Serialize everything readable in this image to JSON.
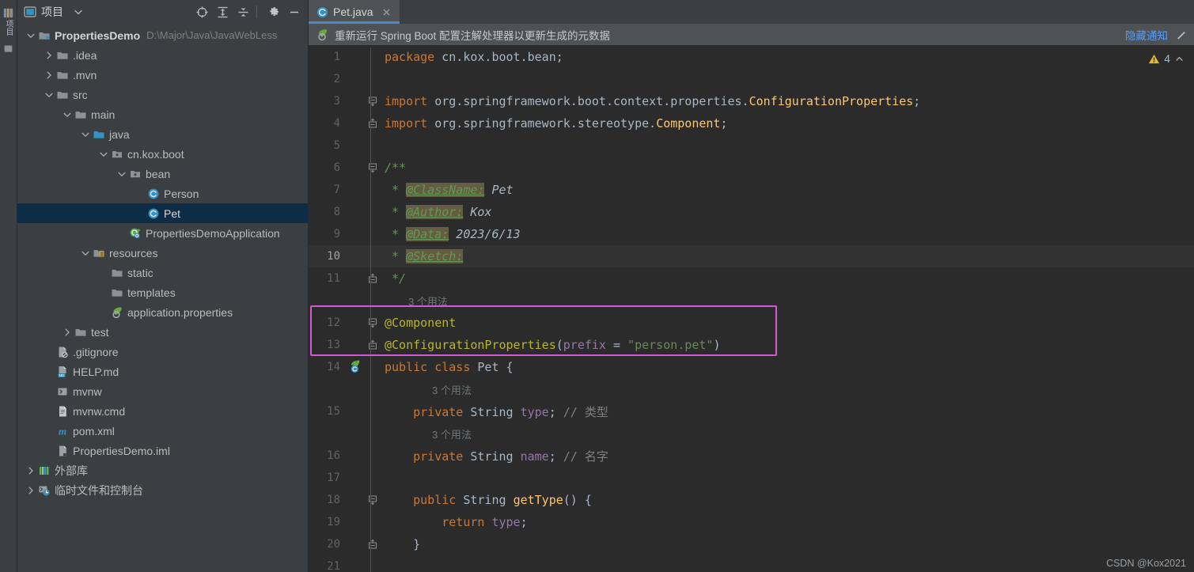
{
  "colors": {
    "panel_bg": "#3c3f41",
    "editor_bg": "#2b2b2b",
    "selection_bg": "#0d2c45",
    "tab_active_underline": "#4a88c7",
    "annotation_box": "#d458d4",
    "link": "#589df6",
    "keyword": "#cc7832",
    "string": "#6a8759",
    "annotation_token": "#bbb529",
    "class_name": "#ffc66d",
    "field": "#9876aa",
    "comment": "#808080",
    "javadoc": "#629755",
    "javadoc_tag_bg": "#645d41"
  },
  "tool_strip": {
    "tab_label": "项目",
    "icon": "project-structure-icon"
  },
  "project_panel": {
    "header": {
      "icon": "project-view-icon",
      "title": "项目",
      "caret_icon": "chevron-down-icon",
      "buttons": [
        {
          "name": "select-opened-file-icon",
          "tooltip": "定位"
        },
        {
          "name": "expand-all-icon",
          "tooltip": "全部展开"
        },
        {
          "name": "collapse-all-icon",
          "tooltip": "全部折叠"
        },
        {
          "name": "settings-gear-icon",
          "tooltip": "设置"
        },
        {
          "name": "minimize-icon",
          "tooltip": "隐藏"
        }
      ]
    },
    "tree": [
      {
        "label": "PropertiesDemo",
        "sublabel": "D:\\Major\\Java\\JavaWebLess",
        "depth": 0,
        "arrow": "expanded",
        "icon": "module-folder-icon",
        "bold": true,
        "selected": false
      },
      {
        "label": ".idea",
        "sublabel": "",
        "depth": 1,
        "arrow": "collapsed",
        "icon": "folder-icon",
        "bold": false,
        "selected": false
      },
      {
        "label": ".mvn",
        "sublabel": "",
        "depth": 1,
        "arrow": "collapsed",
        "icon": "folder-icon",
        "bold": false,
        "selected": false
      },
      {
        "label": "src",
        "sublabel": "",
        "depth": 1,
        "arrow": "expanded",
        "icon": "folder-icon",
        "bold": false,
        "selected": false
      },
      {
        "label": "main",
        "sublabel": "",
        "depth": 2,
        "arrow": "expanded",
        "icon": "folder-icon",
        "bold": false,
        "selected": false
      },
      {
        "label": "java",
        "sublabel": "",
        "depth": 3,
        "arrow": "expanded",
        "icon": "source-root-folder-icon",
        "bold": false,
        "selected": false
      },
      {
        "label": "cn.kox.boot",
        "sublabel": "",
        "depth": 4,
        "arrow": "expanded",
        "icon": "package-icon",
        "bold": false,
        "selected": false
      },
      {
        "label": "bean",
        "sublabel": "",
        "depth": 5,
        "arrow": "expanded",
        "icon": "package-icon",
        "bold": false,
        "selected": false
      },
      {
        "label": "Person",
        "sublabel": "",
        "depth": 6,
        "arrow": "none",
        "icon": "java-class-icon",
        "bold": false,
        "selected": false
      },
      {
        "label": "Pet",
        "sublabel": "",
        "depth": 6,
        "arrow": "none",
        "icon": "java-class-icon",
        "bold": false,
        "selected": true
      },
      {
        "label": "PropertiesDemoApplication",
        "sublabel": "",
        "depth": 5,
        "arrow": "none",
        "icon": "spring-boot-class-icon",
        "bold": false,
        "selected": false
      },
      {
        "label": "resources",
        "sublabel": "",
        "depth": 3,
        "arrow": "expanded",
        "icon": "resources-root-folder-icon",
        "bold": false,
        "selected": false
      },
      {
        "label": "static",
        "sublabel": "",
        "depth": 4,
        "arrow": "none",
        "icon": "folder-icon",
        "bold": false,
        "selected": false
      },
      {
        "label": "templates",
        "sublabel": "",
        "depth": 4,
        "arrow": "none",
        "icon": "folder-icon",
        "bold": false,
        "selected": false
      },
      {
        "label": "application.properties",
        "sublabel": "",
        "depth": 4,
        "arrow": "none",
        "icon": "spring-properties-icon",
        "bold": false,
        "selected": false
      },
      {
        "label": "test",
        "sublabel": "",
        "depth": 2,
        "arrow": "collapsed",
        "icon": "folder-icon",
        "bold": false,
        "selected": false
      },
      {
        "label": ".gitignore",
        "sublabel": "",
        "depth": 1,
        "arrow": "none",
        "icon": "gitignore-file-icon",
        "bold": false,
        "selected": false
      },
      {
        "label": "HELP.md",
        "sublabel": "",
        "depth": 1,
        "arrow": "none",
        "icon": "markdown-file-icon",
        "bold": false,
        "selected": false
      },
      {
        "label": "mvnw",
        "sublabel": "",
        "depth": 1,
        "arrow": "none",
        "icon": "shell-script-icon",
        "bold": false,
        "selected": false
      },
      {
        "label": "mvnw.cmd",
        "sublabel": "",
        "depth": 1,
        "arrow": "none",
        "icon": "cmd-file-icon",
        "bold": false,
        "selected": false
      },
      {
        "label": "pom.xml",
        "sublabel": "",
        "depth": 1,
        "arrow": "none",
        "icon": "maven-pom-icon",
        "bold": false,
        "selected": false
      },
      {
        "label": "PropertiesDemo.iml",
        "sublabel": "",
        "depth": 1,
        "arrow": "none",
        "icon": "iml-file-icon",
        "bold": false,
        "selected": false
      },
      {
        "label": "外部库",
        "sublabel": "",
        "depth": 0,
        "arrow": "collapsed",
        "icon": "external-libraries-icon",
        "bold": false,
        "selected": false
      },
      {
        "label": "临时文件和控制台",
        "sublabel": "",
        "depth": 0,
        "arrow": "collapsed",
        "icon": "scratches-consoles-icon",
        "bold": false,
        "selected": false
      }
    ]
  },
  "editor": {
    "tabs": [
      {
        "label": "Pet.java",
        "icon": "java-class-icon",
        "close_icon": "close-icon",
        "active": true
      }
    ],
    "notification": {
      "icon": "spring-boot-icon",
      "text": "重新运行 Spring Boot 配置注解处理器以更新生成的元数据",
      "link": "隐藏通知",
      "gear_icon": "settings-gear-icon"
    },
    "inspection": {
      "warning_icon": "warning-triangle-icon",
      "warning_count": "4",
      "chevron_icon": "chevron-up-icon"
    },
    "current_line": 10,
    "lines": [
      {
        "num": "1",
        "fold": "none",
        "gutter": "",
        "tokens": [
          {
            "t": "package ",
            "c": "kw"
          },
          {
            "t": "cn.kox.boot.bean",
            "c": "plain"
          },
          {
            "t": ";",
            "c": "plain"
          }
        ]
      },
      {
        "num": "2",
        "fold": "none",
        "gutter": "",
        "tokens": []
      },
      {
        "num": "3",
        "fold": "start",
        "gutter": "",
        "tokens": [
          {
            "t": "import ",
            "c": "kw"
          },
          {
            "t": "org.springframework.boot.context.properties.",
            "c": "plain"
          },
          {
            "t": "ConfigurationProperties",
            "c": "cls"
          },
          {
            "t": ";",
            "c": "plain"
          }
        ]
      },
      {
        "num": "4",
        "fold": "end",
        "gutter": "",
        "tokens": [
          {
            "t": "import ",
            "c": "kw"
          },
          {
            "t": "org.springframework.stereotype.",
            "c": "plain"
          },
          {
            "t": "Component",
            "c": "cls"
          },
          {
            "t": ";",
            "c": "plain"
          }
        ]
      },
      {
        "num": "5",
        "fold": "none",
        "gutter": "",
        "tokens": []
      },
      {
        "num": "6",
        "fold": "start",
        "gutter": "",
        "tokens": [
          {
            "t": "/**",
            "c": "doc"
          }
        ]
      },
      {
        "num": "7",
        "fold": "none",
        "gutter": "",
        "tokens": [
          {
            "t": " * ",
            "c": "doc"
          },
          {
            "t": "@ClassName:",
            "c": "doctag"
          },
          {
            "t": " Pet",
            "c": "docval"
          }
        ]
      },
      {
        "num": "8",
        "fold": "none",
        "gutter": "",
        "tokens": [
          {
            "t": " * ",
            "c": "doc"
          },
          {
            "t": "@Author:",
            "c": "doctag"
          },
          {
            "t": " Kox",
            "c": "docval"
          }
        ]
      },
      {
        "num": "9",
        "fold": "none",
        "gutter": "",
        "tokens": [
          {
            "t": " * ",
            "c": "doc"
          },
          {
            "t": "@Data:",
            "c": "doctag"
          },
          {
            "t": " 2023/6/13",
            "c": "docval"
          }
        ]
      },
      {
        "num": "10",
        "fold": "none",
        "gutter": "",
        "tokens": [
          {
            "t": " * ",
            "c": "doc"
          },
          {
            "t": "@Sketch:",
            "c": "doctag"
          }
        ]
      },
      {
        "num": "11",
        "fold": "end",
        "gutter": "",
        "tokens": [
          {
            "t": " */",
            "c": "doc"
          }
        ]
      },
      {
        "num": "",
        "hint": "3 个用法",
        "indent": 1
      },
      {
        "num": "12",
        "fold": "start",
        "gutter": "",
        "tokens": [
          {
            "t": "@Component",
            "c": "ann"
          }
        ]
      },
      {
        "num": "13",
        "fold": "end",
        "gutter": "",
        "tokens": [
          {
            "t": "@ConfigurationProperties",
            "c": "ann"
          },
          {
            "t": "(",
            "c": "plain"
          },
          {
            "t": "prefix",
            "c": "fld"
          },
          {
            "t": " = ",
            "c": "plain"
          },
          {
            "t": "\"person.pet\"",
            "c": "str"
          },
          {
            "t": ")",
            "c": "plain"
          }
        ]
      },
      {
        "num": "14",
        "fold": "none",
        "gutter": "spring-bean-icon",
        "tokens": [
          {
            "t": "public class ",
            "c": "kw"
          },
          {
            "t": "Pet ",
            "c": "plain"
          },
          {
            "t": "{",
            "c": "plain"
          }
        ]
      },
      {
        "num": "",
        "hint": "3 个用法",
        "indent": 2
      },
      {
        "num": "15",
        "fold": "none",
        "gutter": "",
        "tokens": [
          {
            "t": "    private ",
            "c": "kw"
          },
          {
            "t": "String ",
            "c": "plain"
          },
          {
            "t": "type",
            "c": "fld"
          },
          {
            "t": "; ",
            "c": "plain"
          },
          {
            "t": "// 类型",
            "c": "cmt"
          }
        ]
      },
      {
        "num": "",
        "hint": "3 个用法",
        "indent": 2
      },
      {
        "num": "16",
        "fold": "none",
        "gutter": "",
        "tokens": [
          {
            "t": "    private ",
            "c": "kw"
          },
          {
            "t": "String ",
            "c": "plain"
          },
          {
            "t": "name",
            "c": "fld"
          },
          {
            "t": "; ",
            "c": "plain"
          },
          {
            "t": "// 名字",
            "c": "cmt"
          }
        ]
      },
      {
        "num": "17",
        "fold": "none",
        "gutter": "",
        "tokens": []
      },
      {
        "num": "18",
        "fold": "start",
        "gutter": "",
        "tokens": [
          {
            "t": "    public ",
            "c": "kw"
          },
          {
            "t": "String ",
            "c": "plain"
          },
          {
            "t": "getType",
            "c": "cls"
          },
          {
            "t": "() {",
            "c": "plain"
          }
        ]
      },
      {
        "num": "19",
        "fold": "none",
        "gutter": "",
        "tokens": [
          {
            "t": "        return ",
            "c": "kw"
          },
          {
            "t": "type",
            "c": "fld"
          },
          {
            "t": ";",
            "c": "plain"
          }
        ]
      },
      {
        "num": "20",
        "fold": "end",
        "gutter": "",
        "tokens": [
          {
            "t": "    }",
            "c": "plain"
          }
        ]
      },
      {
        "num": "21",
        "fold": "none",
        "gutter": "",
        "tokens": []
      }
    ],
    "annotation_box": {
      "label": "highlight-box-annotations"
    }
  },
  "watermark": "CSDN @Kox2021"
}
